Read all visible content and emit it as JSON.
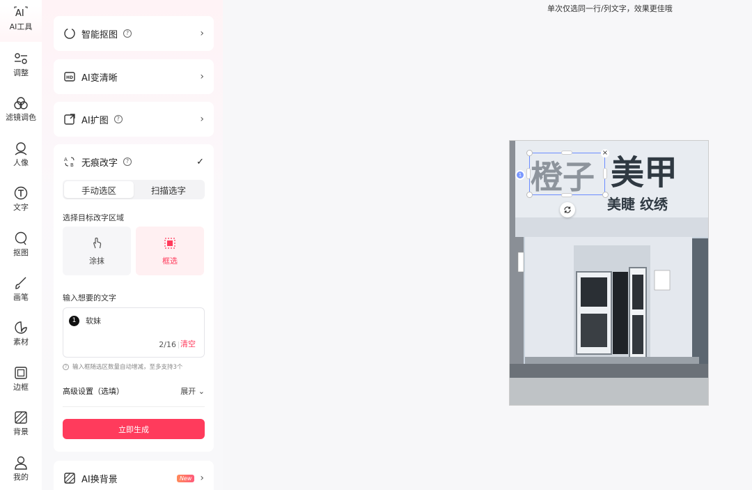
{
  "rail": {
    "items": [
      {
        "label": "AI工具",
        "icon": "ai-tools-icon"
      },
      {
        "label": "调整",
        "icon": "adjust-icon"
      },
      {
        "label": "滤镜调色",
        "icon": "filter-icon"
      },
      {
        "label": "人像",
        "icon": "portrait-icon"
      },
      {
        "label": "文字",
        "icon": "text-icon"
      },
      {
        "label": "抠图",
        "icon": "cutout-icon"
      },
      {
        "label": "画笔",
        "icon": "brush-icon"
      },
      {
        "label": "素材",
        "icon": "sticker-icon"
      },
      {
        "label": "边框",
        "icon": "frame-icon"
      },
      {
        "label": "背景",
        "icon": "background-icon"
      },
      {
        "label": "我的",
        "icon": "user-icon"
      }
    ],
    "ai_glyph": "AI"
  },
  "panel": {
    "smart_cutout": {
      "label": "智能抠图",
      "help": "?"
    },
    "ai_enhance": {
      "label": "AI变清晰"
    },
    "ai_expand": {
      "label": "AI扩图",
      "help": "?"
    },
    "text_removal": {
      "label": "无痕改字",
      "help": "?",
      "check": "✓",
      "tabs": [
        "手动选区",
        "扫描选字"
      ],
      "select_area_label": "选择目标改字区域",
      "modes": [
        {
          "label": "涂抹"
        },
        {
          "label": "框选"
        }
      ],
      "input_label": "输入想要的文字",
      "input": {
        "index": "1",
        "value": "软妹",
        "count": "2/16",
        "clear": "清空"
      },
      "hint": "输入框随选区数量自动增减，至多支持3个",
      "advanced_label": "高级设置（选填）",
      "advanced_toggle": "展开",
      "generate": "立即生成"
    },
    "ai_background": {
      "label": "AI换背景",
      "badge": "New"
    }
  },
  "canvas": {
    "tip": "单次仅选同一行/列文字，效果更佳哦",
    "photo": {
      "sign_left": "橙子",
      "sign_right": "美甲",
      "sign_sub": "美睫 纹绣"
    },
    "selection_index": "1",
    "close": "×"
  },
  "colors": {
    "accent": "#ff3b5c",
    "selection": "#6b8cff"
  }
}
